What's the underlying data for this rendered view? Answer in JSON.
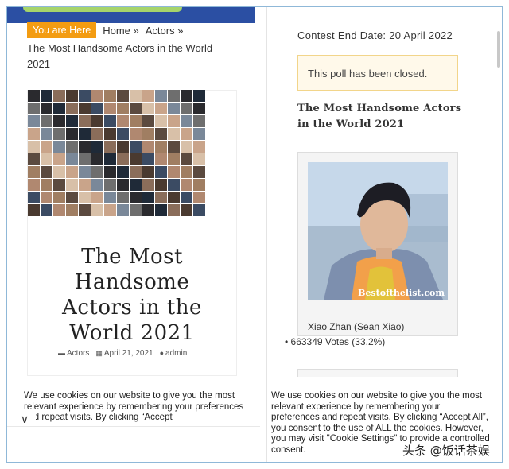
{
  "breadcrumb": {
    "here_label": "You are Here",
    "home_label": "Home »",
    "actors_label": "Actors »",
    "current": "The Most Handsome Actors in the World 2021"
  },
  "post": {
    "title": "The Most Handsome Actors in the World 2021",
    "category": "Actors",
    "date": "April 21, 2021",
    "author": "admin"
  },
  "sidebar": {
    "contest_end": "Contest End Date: 20 April 2022",
    "closed_notice": "This poll has been closed.",
    "poll_title": "The Most Handsome Actors in the World 2021",
    "candidate": {
      "name": "Xiao Zhan (Sean Xiao)",
      "votes": "• 663349 Votes (33.2%)",
      "watermark": "Bestofthelist.com"
    }
  },
  "cookie": {
    "left_text": "We use cookies on our website to give you the most relevant experience by remembering your preferences and repeat visits. By clicking “Accept",
    "right_text": "We use cookies on our website to give you the most relevant experience by remembering your preferences and repeat visits. By clicking “Accept All”, you consent to the use of ALL the cookies. However, you may visit \"Cookie Settings\" to provide a controlled consent."
  },
  "source_watermark": "头条 @饭话茶娱",
  "colors": {
    "breadcrumb_accent": "#f39c12",
    "header_blue": "#2b4fa3",
    "notice_bg": "#fff9ea"
  }
}
